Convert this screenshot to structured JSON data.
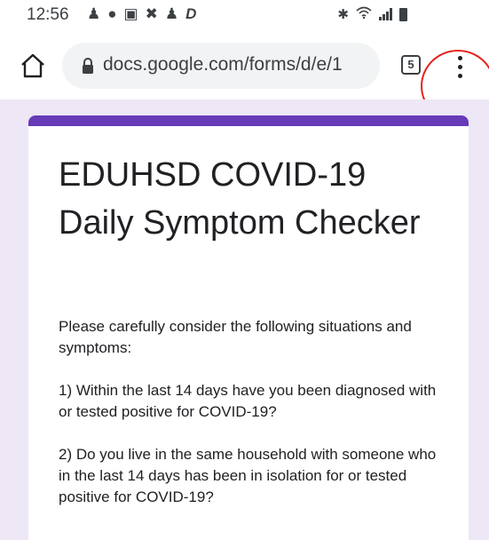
{
  "status_bar": {
    "time": "12:56",
    "notification_icons": [
      "person-icon",
      "messenger-icon",
      "news-icon",
      "tools-icon",
      "person-alt-icon",
      "d-icon"
    ],
    "d_icon_label": "D",
    "system_icons": [
      "bluetooth-icon",
      "wifi-icon",
      "signal-icon",
      "battery-icon"
    ]
  },
  "toolbar": {
    "url": "docs.google.com/forms/d/e/1",
    "tab_count": "5",
    "icons": [
      "home-icon",
      "lock-icon",
      "tabs-icon",
      "more-vert-icon"
    ]
  },
  "annotation": {
    "color": "#e5231b"
  },
  "form": {
    "accent_color": "#673ab7",
    "background_color": "#ede7f6",
    "title": "EDUHSD COVID-19 Daily Symptom Checker",
    "description": [
      "Please carefully consider the following situations and symptoms:",
      "1) Within the last 14 days have you been diagnosed with or tested positive for COVID-19?",
      "2) Do you live in the same household with someone who in the last 14 days has been in isolation for or tested positive for COVID-19?"
    ]
  }
}
